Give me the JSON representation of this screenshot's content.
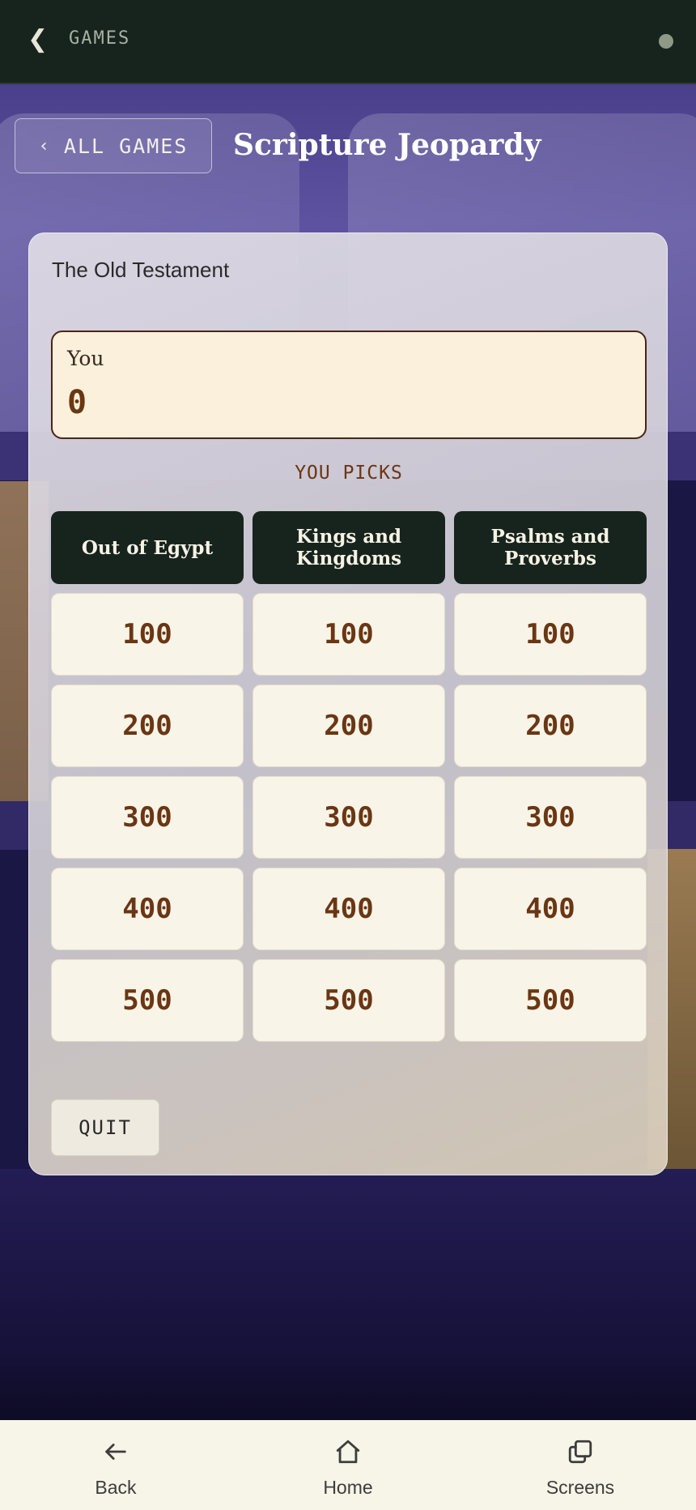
{
  "app_bar": {
    "title": "GAMES"
  },
  "header": {
    "all_games_label": "ALL GAMES",
    "title": "Scripture Jeopardy"
  },
  "game": {
    "subtitle": "The Old Testament",
    "player": {
      "name": "You",
      "score": "0"
    },
    "turn_label": "YOU PICKS",
    "categories": [
      "Out of Egypt",
      "Kings and Kingdoms",
      "Psalms and Proverbs"
    ],
    "values": [
      "100",
      "200",
      "300",
      "400",
      "500"
    ],
    "quit_label": "QUIT"
  },
  "bottom_nav": {
    "back": "Back",
    "home": "Home",
    "screens": "Screens"
  }
}
